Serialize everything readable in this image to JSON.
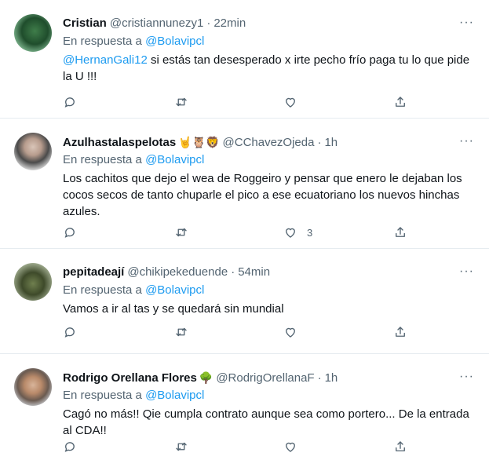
{
  "reply_prefix": "En respuesta a",
  "tweets": [
    {
      "name": "Cristian",
      "handle": "@cristiannunezy1",
      "time": "22min",
      "reply_to": "@Bolavipcl",
      "mention": "@HernanGali12",
      "text": " si estás tan desesperado x irte  pecho frío paga tu lo que pide la U !!!",
      "like_count": ""
    },
    {
      "name": "Azulhastalaspelotas",
      "name_emojis": "🤘🦉🦁",
      "handle": "@CChavezOjeda",
      "time": "1h",
      "reply_to": "@Bolavipcl",
      "text": "Los cachitos que dejo el wea de  Roggeiro y pensar que enero le dejaban los cocos secos de tanto chuparle el pico a ese ecuatoriano los nuevos hinchas azules.",
      "like_count": "3"
    },
    {
      "name": "pepitadeají",
      "handle": "@chikipekeduende",
      "time": "54min",
      "reply_to": "@Bolavipcl",
      "text": "Vamos a ir al tas y se quedará sin mundial",
      "like_count": ""
    },
    {
      "name": "Rodrigo Orellana Flores",
      "name_emojis": "🌳",
      "handle": "@RodrigOrellanaF",
      "time": "1h",
      "reply_to": "@Bolavipcl",
      "text": "Cagó no más!! Qie cumpla contrato aunque sea como portero... De la entrada al CDA!!",
      "like_count": ""
    }
  ],
  "more_glyph": "···",
  "separator": "·",
  "colors": {
    "link": "#1d9bf0",
    "secondary": "#536471",
    "text": "#0f1419",
    "divider": "#e6ecf0"
  },
  "icons": [
    "reply-icon",
    "retweet-icon",
    "like-icon",
    "share-icon",
    "more-icon"
  ]
}
